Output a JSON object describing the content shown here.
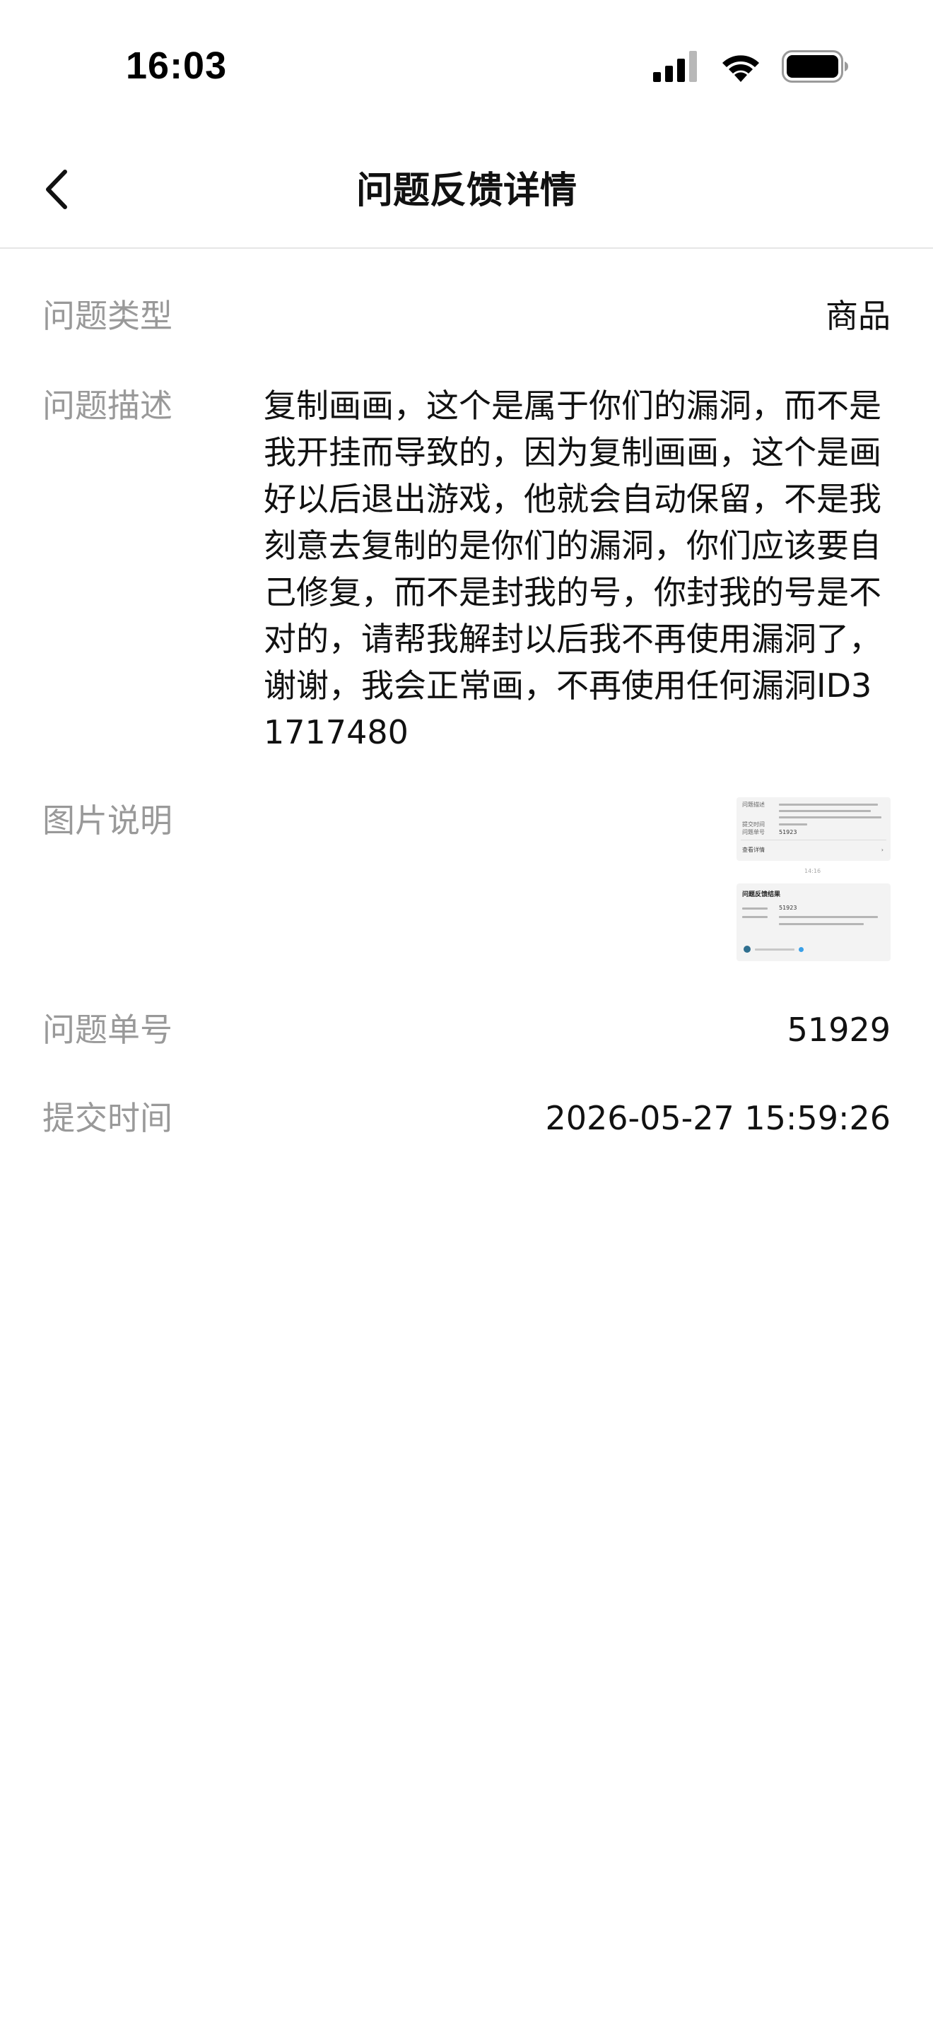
{
  "status_bar": {
    "time": "16:03",
    "icons": [
      "cellular-signal-icon",
      "wifi-icon",
      "battery-icon"
    ]
  },
  "nav": {
    "title": "问题反馈详情",
    "back_icon": "chevron-left-icon"
  },
  "details": {
    "type": {
      "label": "问题类型",
      "value": "商品"
    },
    "description": {
      "label": "问题描述",
      "value": "复制画画，这个是属于你们的漏洞，而不是我开挂而导致的，因为复制画画，这个是画好以后退出游戏，他就会自动保留，不是我刻意去复制的是你们的漏洞，你们应该要自己修复，而不是封我的号，你封我的号是不对的，请帮我解封以后我不再使用漏洞了，谢谢，我会正常画，不再使用任何漏洞ID31717480"
    },
    "images": {
      "label": "图片说明",
      "thumbnail": {
        "card1_rows": [
          "问题描述",
          "提交时间",
          "问题单号"
        ],
        "card1_number": "51923",
        "card1_link": "查看详情",
        "divider_time": "14:16",
        "card2_title": "问题反馈结果",
        "card2_number": "51923"
      }
    },
    "ticket_number": {
      "label": "问题单号",
      "value": "51929"
    },
    "submit_time": {
      "label": "提交时间",
      "value": "2026-05-27 15:59:26"
    }
  },
  "colors": {
    "label": "#999999",
    "value": "#111111",
    "divider": "#e6e6e6",
    "background": "#ffffff"
  }
}
